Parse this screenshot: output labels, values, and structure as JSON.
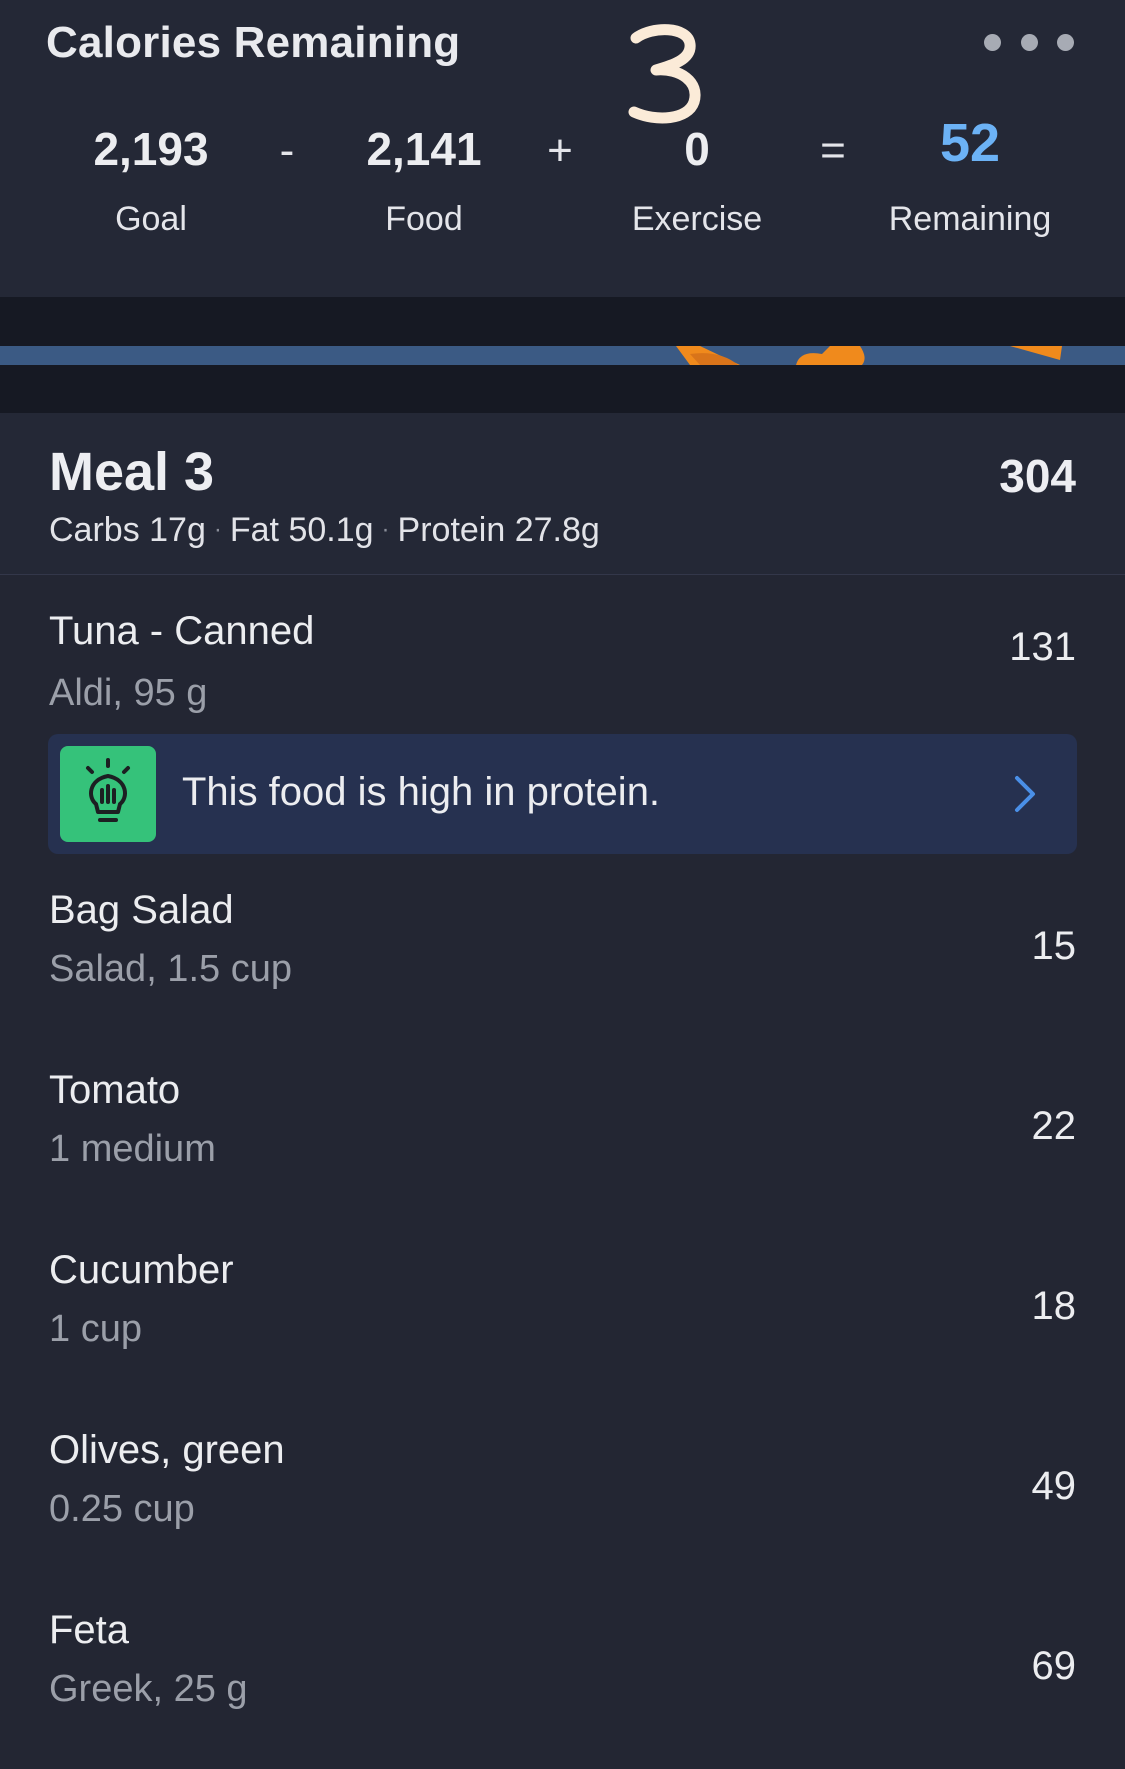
{
  "calories_card": {
    "title": "Calories Remaining",
    "annotation": "3",
    "equation": {
      "goal_value": "2,193",
      "goal_label": "Goal",
      "minus": "-",
      "food_value": "2,141",
      "food_label": "Food",
      "plus": "+",
      "exercise_value": "0",
      "exercise_label": "Exercise",
      "equals": "=",
      "remaining_value": "52",
      "remaining_label": "Remaining"
    },
    "icons": {
      "menu": "more-horizontal-icon"
    }
  },
  "meal": {
    "title": "Meal 3",
    "calories": "304",
    "macros": {
      "carbs": "Carbs 17g",
      "fat": "Fat 50.1g",
      "protein": "Protein 27.8g",
      "separator": "·"
    },
    "items": [
      {
        "name": "Tuna - Canned",
        "desc": "Aldi, 95 g",
        "calories": "131"
      },
      {
        "name": "Bag Salad",
        "desc": "Salad, 1.5 cup",
        "calories": "15"
      },
      {
        "name": "Tomato",
        "desc": "1 medium",
        "calories": "22"
      },
      {
        "name": "Cucumber",
        "desc": "1 cup",
        "calories": "18"
      },
      {
        "name": "Olives, green",
        "desc": "0.25 cup",
        "calories": "49"
      },
      {
        "name": "Feta",
        "desc": "Greek, 25 g",
        "calories": "69"
      }
    ],
    "insight": {
      "text": "This food is high in protein.",
      "icon": "lightbulb-icon",
      "chevron": "chevron-right-icon"
    }
  },
  "colors": {
    "background": "#232633",
    "remaining_accent": "#6CB2F5",
    "insight_background": "#263150",
    "insight_icon_background": "#35C27A",
    "banner_blue": "#3B5A84",
    "banner_orange": "#F08A1C"
  }
}
